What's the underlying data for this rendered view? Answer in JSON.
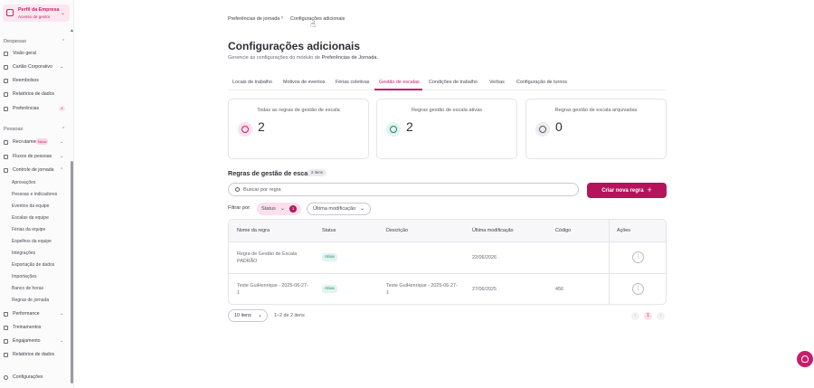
{
  "sidebar": {
    "company": {
      "name": "Perfil da Empresa",
      "role": "Acesso de gestor"
    },
    "sections": [
      {
        "label": "Despesas"
      },
      {
        "label": "Pessoas"
      }
    ],
    "items": {
      "visao_geral": "Visão geral",
      "cartao": "Cartão Corporativo",
      "reembolsos": "Reembolsos",
      "relatorios": "Relatórios de dados",
      "preferencias": "Preferências",
      "preferencias_count": "4",
      "recrutamento": "Recrutamento",
      "recrutamento_badge": "Novo",
      "fluxos": "Fluxos de pessoas",
      "controle": "Controle de jornada",
      "performance": "Performance",
      "treinamentos": "Treinamentos",
      "engajamento": "Engajamento",
      "relatorios2": "Relatórios de dados",
      "configuracoes": "Configurações"
    },
    "subitems": [
      "Aprovações",
      "Pessoas e indicadores",
      "Eventos da equipe",
      "Escalas da equipe",
      "Férias da equipe",
      "Espelhos da equipe",
      "Integrações",
      "Exportação de dados",
      "Importações",
      "Banco de horas",
      "Regras de jornada"
    ]
  },
  "breadcrumb": [
    "Preferências de jornada",
    "Configurações adicionais"
  ],
  "page": {
    "title": "Configurações adicionais",
    "subtitle_prefix": "Gerencie as configurações do módulo de ",
    "subtitle_bold": "Preferências de Jornada."
  },
  "tabs": [
    "Locais de trabalho",
    "Motivos de eventos",
    "Férias coletivas",
    "Gestão de escalas",
    "Condições de trabalho",
    "Verbas",
    "Configuração de turnos"
  ],
  "active_tab": "Gestão de escalas",
  "cards": [
    {
      "label": "Todas as regras de gestão de escala",
      "value": "2",
      "icon": "clock-icon",
      "color": "#fbe0ec"
    },
    {
      "label": "Regras gestão de escala ativas",
      "value": "2",
      "icon": "clock-icon",
      "color": "#dff5ef"
    },
    {
      "label": "Regras gestão de escala arquivadas",
      "value": "0",
      "icon": "clock-icon",
      "color": "#ececf0"
    }
  ],
  "section": {
    "title": "Regras de gestão de escala",
    "count": "2 itens"
  },
  "search": {
    "placeholder": "Buscar por regra"
  },
  "create_button": "Criar nova regra",
  "filters": {
    "label": "Filtrar por:",
    "status": "Status",
    "status_count": "1",
    "modified": "Última modificação"
  },
  "table": {
    "columns": [
      "Nome da regra",
      "Status",
      "Descrição",
      "Última modificação",
      "Código",
      "Ações"
    ],
    "rows": [
      {
        "name": "Regra de Gestão de Escala PADRÃO",
        "status": "Ativa",
        "description": "",
        "modified": "22/06/2026",
        "code": ""
      },
      {
        "name": "Teste GuiHenrique - 2025-06-27-1",
        "status": "Ativa",
        "description": "Teste GuiHenrique - 2025-06-27-1",
        "modified": "27/06/2025",
        "code": "456"
      }
    ]
  },
  "pagination": {
    "per_page": "10 itens",
    "range": "1–2 de 2 itens",
    "current_page": "1"
  },
  "colors": {
    "accent": "#c81e6a",
    "button": "#b5145b"
  }
}
